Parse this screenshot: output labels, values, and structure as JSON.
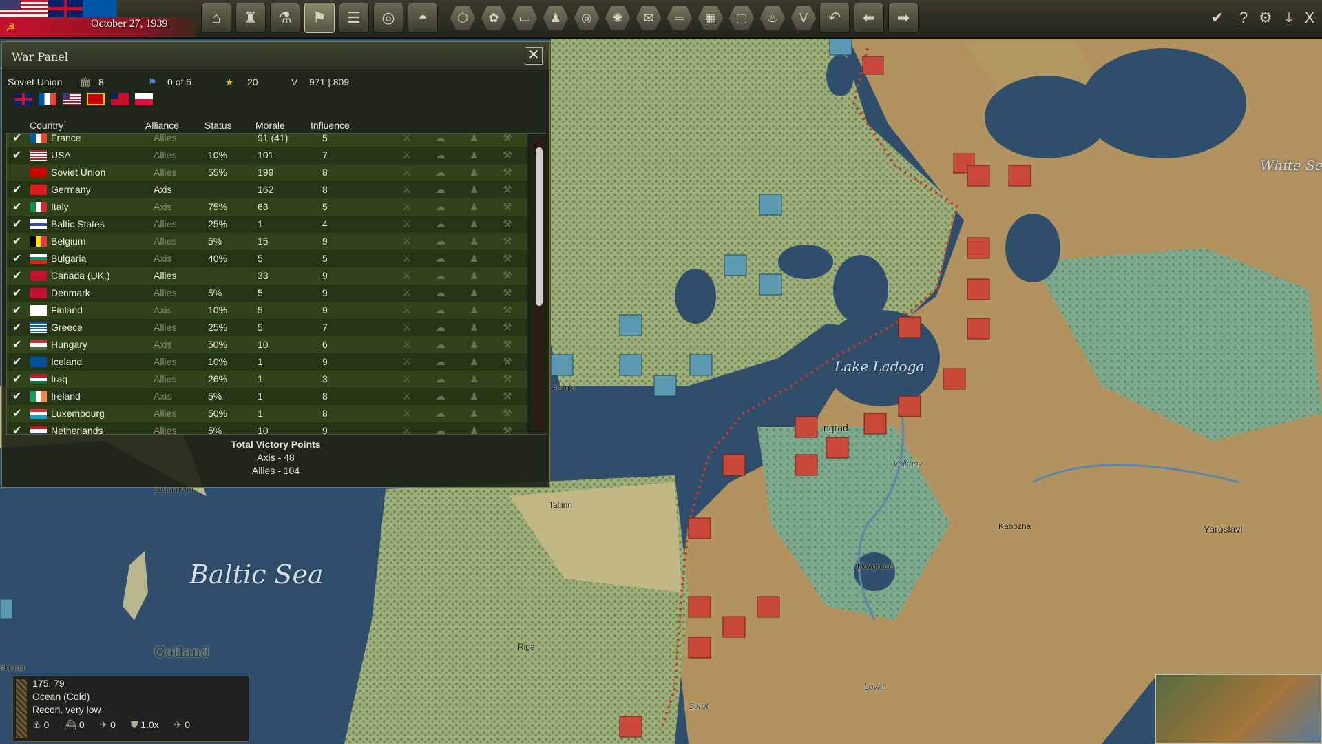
{
  "topbar": {
    "date": "October 27, 1939",
    "buttons": [
      {
        "name": "factory-icon",
        "glyph": "⌂"
      },
      {
        "name": "production-icon",
        "glyph": "♜"
      },
      {
        "name": "research-icon",
        "glyph": "⚗"
      },
      {
        "name": "war-flag-icon",
        "glyph": "⚑",
        "active": true
      },
      {
        "name": "reports-icon",
        "glyph": "☰"
      },
      {
        "name": "recon-binoculars-icon",
        "glyph": "◎"
      },
      {
        "name": "helmet-icon",
        "glyph": "◓"
      }
    ],
    "hexbuttons": [
      {
        "name": "hex-grid-icon",
        "glyph": "⬡"
      },
      {
        "name": "resources-icon",
        "glyph": "✿"
      },
      {
        "name": "tank-filter-icon",
        "glyph": "▭"
      },
      {
        "name": "units-filter-icon",
        "glyph": "♟"
      },
      {
        "name": "target-icon",
        "glyph": "◎"
      },
      {
        "name": "weather-icon",
        "glyph": "✺"
      },
      {
        "name": "supply-icon",
        "glyph": "✉"
      },
      {
        "name": "rail-icon",
        "glyph": "═"
      },
      {
        "name": "grid-icon",
        "glyph": "▦"
      },
      {
        "name": "zone-icon",
        "glyph": "▢"
      },
      {
        "name": "fire-icon",
        "glyph": "♨"
      },
      {
        "name": "victory-v-icon",
        "glyph": "V"
      }
    ],
    "navbuttons": [
      {
        "name": "undo-icon",
        "glyph": "↶"
      },
      {
        "name": "arrow-left-icon",
        "glyph": "⬅"
      },
      {
        "name": "arrow-right-icon",
        "glyph": "➡"
      }
    ],
    "rightbuttons": [
      {
        "name": "end-turn-check-icon",
        "glyph": "✔"
      },
      {
        "name": "help-icon",
        "glyph": "?"
      },
      {
        "name": "settings-gears-icon",
        "glyph": "⚙"
      },
      {
        "name": "save-download-icon",
        "glyph": "⤓"
      },
      {
        "name": "exit-icon",
        "glyph": "X"
      }
    ]
  },
  "war_panel": {
    "title": "War Panel",
    "country": "Soviet Union",
    "factories": "8",
    "flags": "0 of 5",
    "stars": "20",
    "victory": "971 | 809",
    "columns": {
      "country": "Country",
      "alliance": "Alliance",
      "status": "Status",
      "morale": "Morale",
      "influence": "Influence"
    },
    "rows": [
      {
        "country": "France",
        "alliance": "Allies",
        "status": "",
        "morale": "91 (41)",
        "influence": "5",
        "check": true,
        "flag": "fr",
        "ally_bright": false
      },
      {
        "country": "USA",
        "alliance": "Allies",
        "status": "10%",
        "morale": "101",
        "influence": "7",
        "check": true,
        "flag": "us",
        "ally_bright": false
      },
      {
        "country": "Soviet Union",
        "alliance": "Allies",
        "status": "55%",
        "morale": "199",
        "influence": "8",
        "check": false,
        "flag": "su",
        "ally_bright": false
      },
      {
        "country": "Germany",
        "alliance": "Axis",
        "status": "",
        "morale": "162",
        "influence": "8",
        "check": true,
        "flag": "de",
        "ally_bright": true
      },
      {
        "country": "Italy",
        "alliance": "Axis",
        "status": "75%",
        "morale": "63",
        "influence": "5",
        "check": true,
        "flag": "it",
        "ally_bright": false
      },
      {
        "country": "Baltic States",
        "alliance": "Allies",
        "status": "25%",
        "morale": "1",
        "influence": "4",
        "check": true,
        "flag": "bs",
        "ally_bright": false
      },
      {
        "country": "Belgium",
        "alliance": "Allies",
        "status": "5%",
        "morale": "15",
        "influence": "9",
        "check": true,
        "flag": "be",
        "ally_bright": false
      },
      {
        "country": "Bulgaria",
        "alliance": "Axis",
        "status": "40%",
        "morale": "5",
        "influence": "5",
        "check": true,
        "flag": "bg",
        "ally_bright": false
      },
      {
        "country": "Canada (UK.)",
        "alliance": "Allies",
        "status": "",
        "morale": "33",
        "influence": "9",
        "check": true,
        "flag": "ca",
        "ally_bright": true
      },
      {
        "country": "Denmark",
        "alliance": "Allies",
        "status": "5%",
        "morale": "5",
        "influence": "9",
        "check": true,
        "flag": "dk",
        "ally_bright": false
      },
      {
        "country": "Finland",
        "alliance": "Axis",
        "status": "10%",
        "morale": "5",
        "influence": "9",
        "check": true,
        "flag": "fi",
        "ally_bright": false
      },
      {
        "country": "Greece",
        "alliance": "Allies",
        "status": "25%",
        "morale": "5",
        "influence": "7",
        "check": true,
        "flag": "gr",
        "ally_bright": false
      },
      {
        "country": "Hungary",
        "alliance": "Axis",
        "status": "50%",
        "morale": "10",
        "influence": "6",
        "check": true,
        "flag": "hu",
        "ally_bright": false
      },
      {
        "country": "Iceland",
        "alliance": "Allies",
        "status": "10%",
        "morale": "1",
        "influence": "9",
        "check": true,
        "flag": "is",
        "ally_bright": false
      },
      {
        "country": "Iraq",
        "alliance": "Allies",
        "status": "26%",
        "morale": "1",
        "influence": "3",
        "check": true,
        "flag": "iq",
        "ally_bright": false
      },
      {
        "country": "Ireland",
        "alliance": "Axis",
        "status": "5%",
        "morale": "1",
        "influence": "8",
        "check": true,
        "flag": "ie",
        "ally_bright": false
      },
      {
        "country": "Luxembourg",
        "alliance": "Allies",
        "status": "50%",
        "morale": "1",
        "influence": "8",
        "check": true,
        "flag": "lu",
        "ally_bright": false
      },
      {
        "country": "Netherlands",
        "alliance": "Allies",
        "status": "5%",
        "morale": "10",
        "influence": "9",
        "check": true,
        "flag": "nl",
        "ally_bright": false
      }
    ],
    "total_vp_title": "Total Victory Points",
    "axis_vp": "Axis - 48",
    "allies_vp": "Allies - 104"
  },
  "info_box": {
    "coords": "175, 79",
    "terrain": "Ocean (Cold)",
    "recon": "Recon. very low",
    "anchor": "0",
    "ships": "0",
    "planes": "0",
    "defense": "1.0x",
    "air": "0"
  },
  "map_labels": {
    "baltic_sea": "Baltic Sea",
    "lake_ladoga": "Lake Ladoga",
    "white_sea": "White Se",
    "gotland": "Gotland",
    "cities": [
      {
        "text": "Tallinn"
      },
      {
        "text": "Riga"
      },
      {
        "text": "Novgorod"
      },
      {
        "text": "Kabozha"
      },
      {
        "text": "Yaroslavl"
      },
      {
        "text": "Volkhov"
      },
      {
        "text": "Lovat"
      },
      {
        "text": "Sorot"
      },
      {
        "text": "Stockholm"
      },
      {
        "text": "elsinki"
      },
      {
        "text": "ngrad"
      },
      {
        "text": "skrona"
      }
    ]
  },
  "colors": {
    "axis_red": "#c9483a",
    "allies_blue": "#5b9ab0",
    "panel_green": "#2f4219"
  }
}
